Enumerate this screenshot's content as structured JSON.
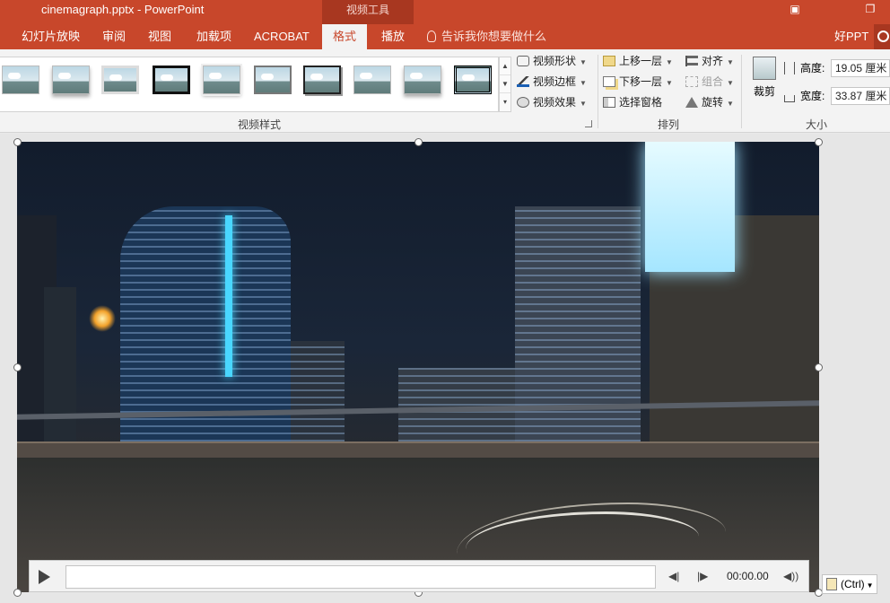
{
  "window": {
    "title": "cinemagraph.pptx - PowerPoint",
    "context_group": "视频工具",
    "buttons": [
      "restore",
      "maximize"
    ]
  },
  "tabs": [
    {
      "label": "幻灯片放映",
      "active": false
    },
    {
      "label": "审阅",
      "active": false
    },
    {
      "label": "视图",
      "active": false
    },
    {
      "label": "加载项",
      "active": false
    },
    {
      "label": "ACROBAT",
      "active": false
    },
    {
      "label": "格式",
      "active": true
    },
    {
      "label": "播放",
      "active": false
    }
  ],
  "tell_me": "告诉我你想要做什么",
  "user": "好PPT",
  "ribbon": {
    "video_styles": {
      "label": "视频样式",
      "items": [
        "视频形状",
        "视频边框",
        "视频效果"
      ]
    },
    "arrange": {
      "label": "排列",
      "items": [
        "上移一层",
        "下移一层",
        "选择窗格",
        "对齐",
        "组合",
        "旋转"
      ]
    },
    "size": {
      "label": "大小",
      "crop": "裁剪",
      "height_label": "高度:",
      "height_value": "19.05 厘米",
      "width_label": "宽度:",
      "width_value": "33.87 厘米"
    }
  },
  "player": {
    "time": "00:00.00"
  },
  "paste_options": "(Ctrl)",
  "colors": {
    "accent": "#c8472b",
    "context": "#a83720"
  }
}
